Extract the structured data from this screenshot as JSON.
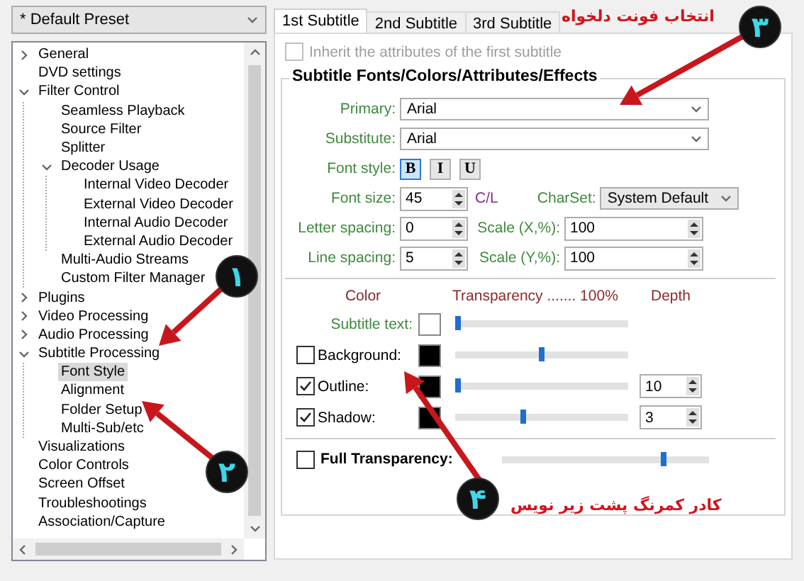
{
  "preset": {
    "value": "* Default Preset"
  },
  "tree": [
    {
      "label": "General",
      "expanded": false,
      "selected": false
    },
    {
      "label": "DVD settings",
      "selected": false
    },
    {
      "label": "Filter Control",
      "expanded": true,
      "selected": false,
      "children": [
        {
          "label": "Seamless Playback",
          "selected": false
        },
        {
          "label": "Source Filter",
          "selected": false
        },
        {
          "label": "Splitter",
          "selected": false
        },
        {
          "label": "Decoder Usage",
          "expanded": true,
          "selected": false,
          "children": [
            {
              "label": "Internal Video Decoder",
              "selected": false
            },
            {
              "label": "External Video Decoder",
              "selected": false
            },
            {
              "label": "Internal Audio Decoder",
              "selected": false
            },
            {
              "label": "External Audio Decoder",
              "selected": false
            }
          ]
        },
        {
          "label": "Multi-Audio Streams",
          "selected": false
        },
        {
          "label": "Custom Filter Manager",
          "selected": false
        }
      ]
    },
    {
      "label": "Plugins",
      "expanded": false,
      "selected": false
    },
    {
      "label": "Video Processing",
      "expanded": false,
      "selected": false
    },
    {
      "label": "Audio Processing",
      "expanded": false,
      "selected": false
    },
    {
      "label": "Subtitle Processing",
      "expanded": true,
      "selected": false,
      "children": [
        {
          "label": "Font Style",
          "selected": true
        },
        {
          "label": "Alignment",
          "selected": false
        },
        {
          "label": "Folder Setup",
          "selected": false
        },
        {
          "label": "Multi-Sub/etc",
          "selected": false
        }
      ]
    },
    {
      "label": "Visualizations",
      "selected": false
    },
    {
      "label": "Color Controls",
      "selected": false
    },
    {
      "label": "Screen Offset",
      "selected": false
    },
    {
      "label": "Troubleshootings",
      "selected": false
    },
    {
      "label": "Association/Capture",
      "selected": false
    }
  ],
  "tabs": [
    {
      "label": "1st Subtitle",
      "selected": true
    },
    {
      "label": "2nd Subtitle",
      "selected": false
    },
    {
      "label": "3rd Subtitle",
      "selected": false
    }
  ],
  "inherit": {
    "label": "Inherit the attributes of the first subtitle",
    "checked": false,
    "disabled": true
  },
  "group_title": "Subtitle Fonts/Colors/Attributes/Effects",
  "primary": {
    "label": "Primary:",
    "value": "Arial"
  },
  "substitute": {
    "label": "Substitute:",
    "value": "Arial"
  },
  "font_style": {
    "label": "Font style:",
    "buttons": [
      {
        "label": "B",
        "on": true
      },
      {
        "label": "I",
        "on": false
      },
      {
        "label": "U",
        "on": false
      }
    ]
  },
  "font_size": {
    "label": "Font size:",
    "value": "45"
  },
  "cl": "C/L",
  "charset": {
    "label": "CharSet:",
    "value": "System Default"
  },
  "letter_spacing": {
    "label": "Letter spacing:",
    "value": "0"
  },
  "scale_x": {
    "label": "Scale (X,%):",
    "value": "100"
  },
  "line_spacing": {
    "label": "Line spacing:",
    "value": "5"
  },
  "scale_y": {
    "label": "Scale (Y,%):",
    "value": "100"
  },
  "headers": [
    "Color",
    "Transparency ....... 100%",
    "Depth"
  ],
  "layers": [
    {
      "kind": "plain",
      "label": "Subtitle text:",
      "color": "#ffffff",
      "level": 0.02
    },
    {
      "kind": "check",
      "label": "Background:",
      "checked": false,
      "color": "#000000",
      "level": 0.5
    },
    {
      "kind": "check",
      "label": "Outline:",
      "checked": true,
      "color": "#000000",
      "level": 0.02,
      "depth": "10"
    },
    {
      "kind": "check",
      "label": "Shadow:",
      "checked": true,
      "color": "#000000",
      "level": 0.39,
      "depth": "3"
    }
  ],
  "full_transparency": {
    "label": "Full Transparency:",
    "checked": false,
    "level": 0.78
  },
  "annotations": [
    {
      "number": "۱"
    },
    {
      "number": "۲"
    },
    {
      "number": "۳",
      "caption": "انتخاب فونت دلخواه"
    },
    {
      "number": "۴",
      "caption": "کادر کمرنگ پشت زیر نویس"
    }
  ]
}
